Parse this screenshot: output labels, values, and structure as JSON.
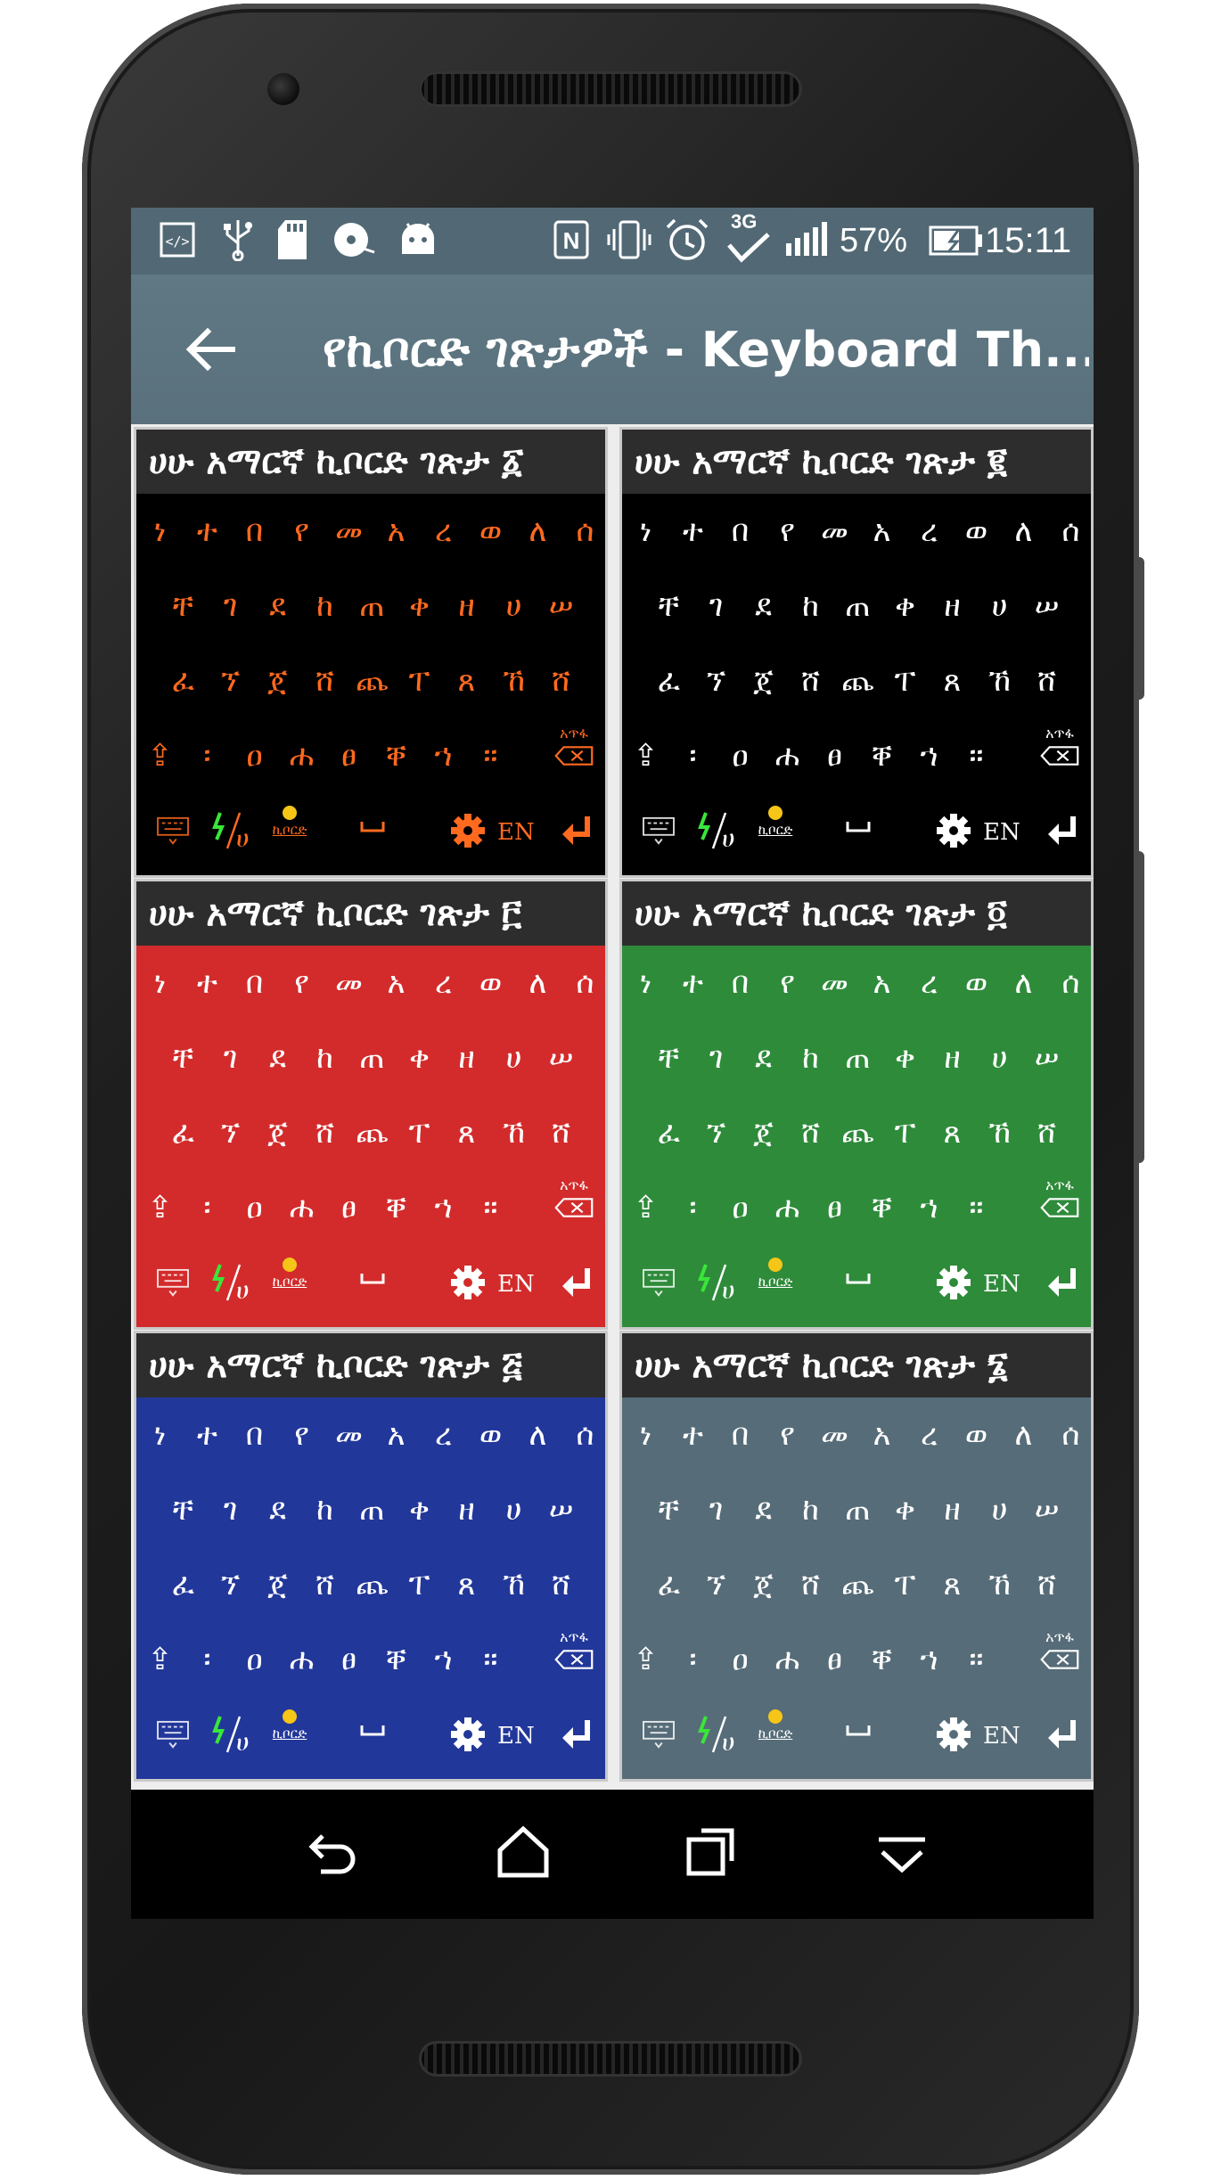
{
  "status_bar": {
    "icons": [
      "developer-icon",
      "usb-icon",
      "sd-card-icon",
      "disc-icon",
      "android-icon",
      "nfc-icon",
      "vibrate-icon",
      "alarm-icon",
      "3g-icon",
      "signal-icon",
      "battery-icon"
    ],
    "network_label": "3G",
    "battery_percent": "57%",
    "time": "15:11"
  },
  "app_bar": {
    "title": "የኪቦርድ ገጽታዎች - Keyboard Th..."
  },
  "keyboard_rows": {
    "row1": [
      "ነ",
      "ተ",
      "በ",
      "የ",
      "መ",
      "አ",
      "ረ",
      "ወ",
      "ለ",
      "ሰ"
    ],
    "row2": [
      "ቸ",
      "ገ",
      "ደ",
      "ከ",
      "ጠ",
      "ቀ",
      "ዘ",
      "ሀ",
      "ሠ"
    ],
    "row3": [
      "ፈ",
      "ኘ",
      "ጀ",
      "ሸ",
      "ጨ",
      "ፐ",
      "ጸ",
      "ኸ",
      "ሸ"
    ],
    "row4": [
      "⇪",
      "፡",
      "ዐ",
      "ሐ",
      "ፀ",
      "ቐ",
      "ኀ",
      "።"
    ],
    "delete_label": "አጥፋ",
    "lang_label": "EN",
    "fraction_label": "ሀ",
    "keyboard_sub": "ኪቦርድ"
  },
  "themes": [
    {
      "title": "ሀሁ አማርኛ ኪቦርድ ገጽታ ፩",
      "bg": "#000000",
      "text": "#ff6a1f",
      "name": "theme-1"
    },
    {
      "title": "ሀሁ አማርኛ ኪቦርድ ገጽታ ፪",
      "bg": "#000000",
      "text": "#ffffff",
      "name": "theme-2"
    },
    {
      "title": "ሀሁ አማርኛ ኪቦርድ ገጽታ ፫",
      "bg": "#d32b2b",
      "text": "#ffffff",
      "name": "theme-3"
    },
    {
      "title": "ሀሁ አማርኛ ኪቦርድ ገጽታ ፬",
      "bg": "#2e8b3a",
      "text": "#ffffff",
      "name": "theme-4"
    },
    {
      "title": "ሀሁ አማርኛ ኪቦርድ ገጽታ ፭",
      "bg": "#22379a",
      "text": "#ffffff",
      "name": "theme-5"
    },
    {
      "title": "ሀሁ አማርኛ ኪቦርድ ገጽታ ፮",
      "bg": "#566c78",
      "text": "#ffffff",
      "name": "theme-6"
    }
  ],
  "colors": {
    "status_bar": "#526975",
    "app_bar": "#5c737f",
    "card_title_bg": "#2d2d2d",
    "nav_bar": "#000000",
    "accent_green": "#39e639"
  }
}
